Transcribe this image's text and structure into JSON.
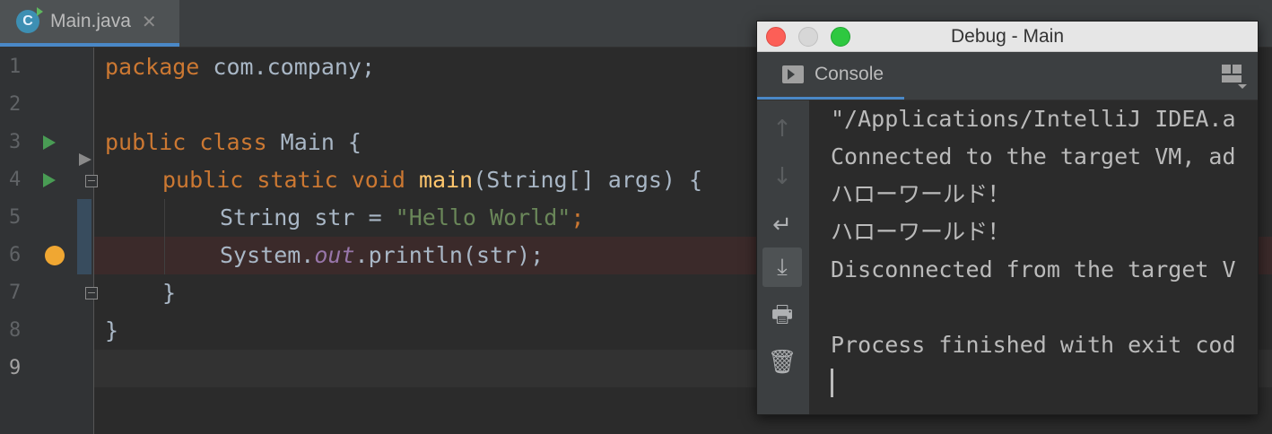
{
  "editor_tab": {
    "icon_letter": "C",
    "label": "Main.java",
    "close_glyph": "✕"
  },
  "gutter": {
    "line_numbers": [
      "1",
      "2",
      "3",
      "4",
      "5",
      "6",
      "7",
      "8",
      "9"
    ],
    "current_line": "9"
  },
  "code": {
    "line1": {
      "kw": "package",
      "rest": " com.company;"
    },
    "line3": {
      "kw": "public class",
      "rest": " Main {"
    },
    "line4": {
      "kw": "public static void",
      "fn": "main",
      "rest": "(String[] args) {"
    },
    "line5": {
      "pre": "String str = ",
      "str": "\"Hello World\"",
      "post": ";"
    },
    "line6": {
      "pre": "System.",
      "field": "out",
      "post": ".println(str);"
    },
    "line7": "}",
    "line8": "}"
  },
  "debug_window": {
    "title": "Debug - Main",
    "tab_label": "Console",
    "toolbar": {
      "up_glyph": "↑",
      "down_glyph": "↓",
      "wrap_glyph": "↵",
      "scroll_end_glyph": "⤓",
      "print_glyph": "🖶",
      "trash_glyph": "🗑"
    },
    "output": [
      "\"/Applications/IntelliJ IDEA.a",
      "Connected to the target VM, ad",
      "ハローワールド！",
      "ハローワールド！",
      "Disconnected from the target V",
      "",
      "Process finished with exit cod"
    ]
  },
  "colors": {
    "keyword": "#cc7832",
    "function": "#ffc66d",
    "string": "#6a8759",
    "field": "#9876aa",
    "default_text": "#a9b7c6",
    "accent": "#4a88c7",
    "breakpoint": "#f0a732",
    "run": "#499c54"
  },
  "icons": [
    "java-class-icon",
    "close-icon",
    "run-icon",
    "breakpoint-icon",
    "fold-icon",
    "console-icon",
    "layout-icon",
    "arrow-up-icon",
    "arrow-down-icon",
    "soft-wrap-icon",
    "scroll-to-end-icon",
    "print-icon",
    "trash-icon"
  ]
}
